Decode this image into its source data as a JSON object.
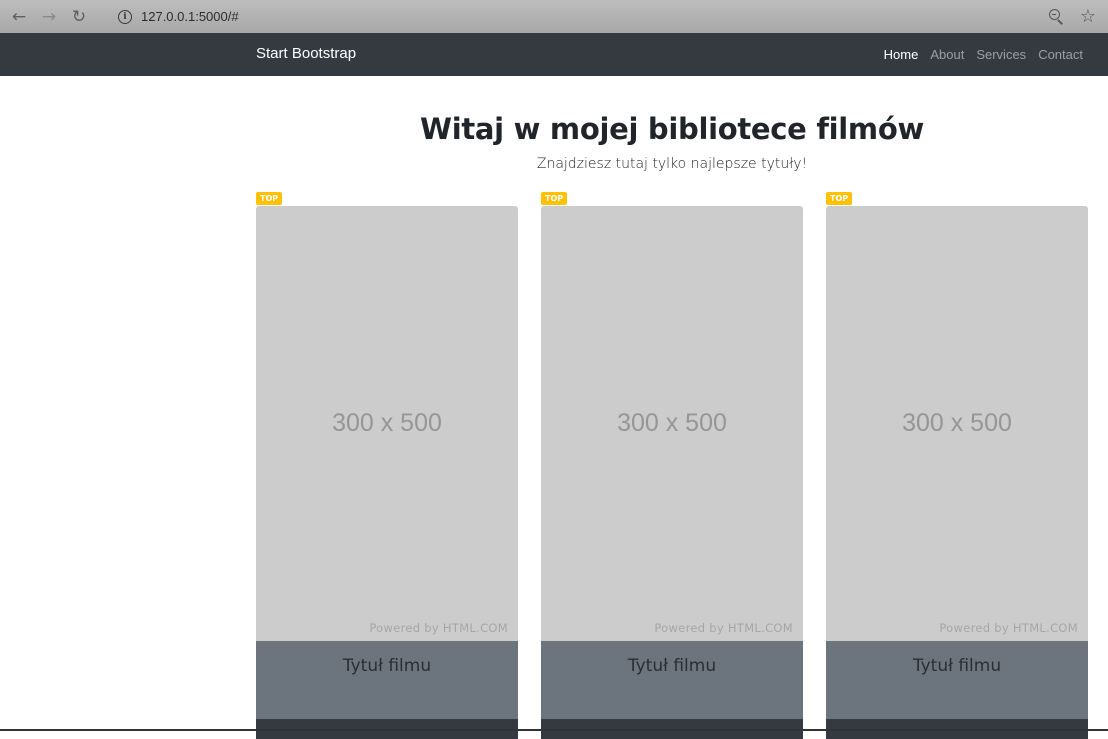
{
  "browser": {
    "url": "127.0.0.1:5000/#",
    "back_icon": "arrow-left",
    "forward_icon": "arrow-right",
    "reload_icon": "reload",
    "info_symbol": "i"
  },
  "navbar": {
    "brand": "Start Bootstrap",
    "links": [
      {
        "label": "Home",
        "active": true
      },
      {
        "label": "About",
        "active": false
      },
      {
        "label": "Services",
        "active": false
      },
      {
        "label": "Contact",
        "active": false
      }
    ]
  },
  "hero": {
    "title": "Witaj w mojej bibliotece filmów",
    "subtitle": "Znajdziesz tutaj tylko najlepsze tytuły!"
  },
  "cards": [
    {
      "badge": "TOP",
      "placeholder": "300 x 500",
      "powered": "Powered by HTML.COM",
      "title": "Tytuł filmu"
    },
    {
      "badge": "TOP",
      "placeholder": "300 x 500",
      "powered": "Powered by HTML.COM",
      "title": "Tytuł filmu"
    },
    {
      "badge": "TOP",
      "placeholder": "300 x 500",
      "powered": "Powered by HTML.COM",
      "title": "Tytuł filmu"
    }
  ],
  "colors": {
    "navbar": "#343a40",
    "badge": "#ffc107",
    "poster": "#cccccc",
    "title_bar": "#6c757d"
  }
}
